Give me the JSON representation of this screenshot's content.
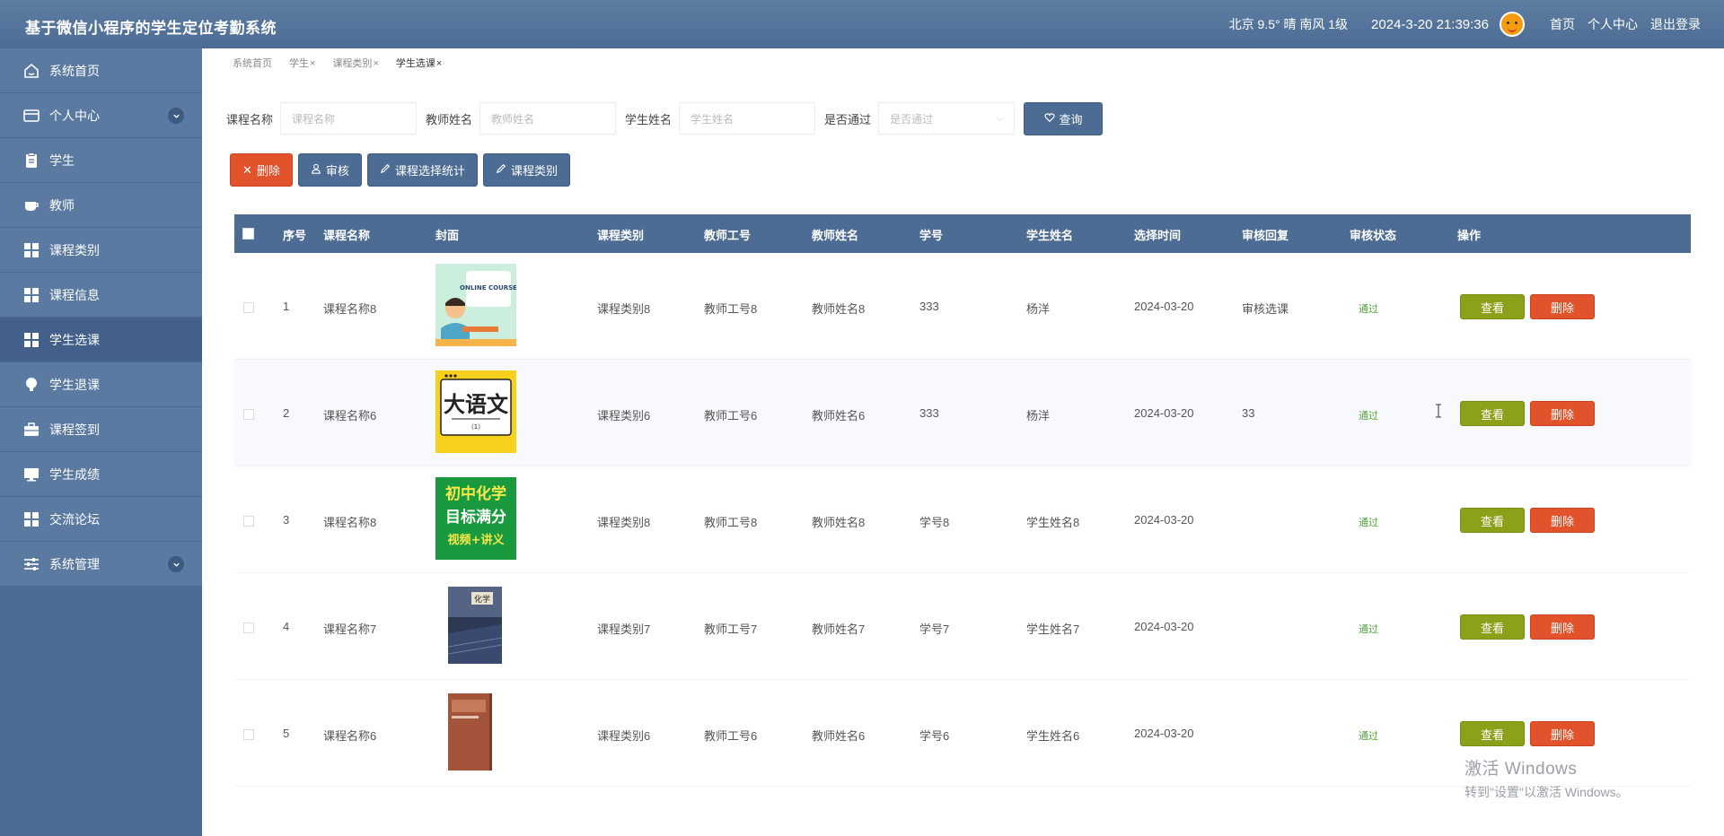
{
  "header": {
    "app_title": "基于微信小程序的学生定位考勤系统",
    "weather": "北京  9.5°  晴  南风  1级",
    "datetime": "2024-3-20 21:39:36",
    "links": [
      "首页",
      "个人中心",
      "退出登录"
    ]
  },
  "sidebar": {
    "items": [
      {
        "label": "系统首页",
        "icon": "home-icon"
      },
      {
        "label": "个人中心",
        "icon": "card-icon",
        "expandable": true
      },
      {
        "label": "学生",
        "icon": "clipboard-icon"
      },
      {
        "label": "教师",
        "icon": "cup-icon"
      },
      {
        "label": "课程类别",
        "icon": "grid-icon"
      },
      {
        "label": "课程信息",
        "icon": "grid-icon"
      },
      {
        "label": "学生选课",
        "icon": "grid-icon",
        "active": true
      },
      {
        "label": "学生退课",
        "icon": "bulb-icon"
      },
      {
        "label": "课程签到",
        "icon": "briefcase-icon"
      },
      {
        "label": "学生成绩",
        "icon": "monitor-icon"
      },
      {
        "label": "交流论坛",
        "icon": "grid-icon"
      },
      {
        "label": "系统管理",
        "icon": "sliders-icon",
        "expandable": true
      }
    ]
  },
  "tabs": [
    {
      "label": "系统首页",
      "closable": false
    },
    {
      "label": "学生",
      "closable": true
    },
    {
      "label": "课程类别",
      "closable": true
    },
    {
      "label": "学生选课",
      "closable": true,
      "active": true
    }
  ],
  "search": {
    "course_label": "课程名称",
    "course_placeholder": "课程名称",
    "teacher_label": "教师姓名",
    "teacher_placeholder": "教师姓名",
    "student_label": "学生姓名",
    "student_placeholder": "学生姓名",
    "passed_label": "是否通过",
    "passed_placeholder": "是否通过",
    "query_button": "查询"
  },
  "actions": {
    "delete": "删除",
    "review": "审核",
    "stats": "课程选择统计",
    "category": "课程类别"
  },
  "table": {
    "columns": [
      "序号",
      "课程名称",
      "封面",
      "课程类别",
      "教师工号",
      "教师姓名",
      "学号",
      "学生姓名",
      "选择时间",
      "审核回复",
      "审核状态",
      "操作"
    ],
    "rows": [
      {
        "no": "1",
        "course": "课程名称8",
        "category": "课程类别8",
        "teacher_id": "教师工号8",
        "teacher": "教师姓名8",
        "student_id": "333",
        "student": "杨洋",
        "time": "2024-03-20",
        "reply": "审核选课",
        "status": "通过",
        "cover": "online-course",
        "cover_text": "ONLINE COURSE"
      },
      {
        "no": "2",
        "course": "课程名称6",
        "category": "课程类别6",
        "teacher_id": "教师工号6",
        "teacher": "教师姓名6",
        "student_id": "333",
        "student": "杨洋",
        "time": "2024-03-20",
        "reply": "33",
        "status": "通过",
        "cover": "dayuwen",
        "cover_text": "大语文",
        "cover_subtext": "（1）"
      },
      {
        "no": "3",
        "course": "课程名称8",
        "category": "课程类别8",
        "teacher_id": "教师工号8",
        "teacher": "教师姓名8",
        "student_id": "学号8",
        "student": "学生姓名8",
        "time": "2024-03-20",
        "reply": "",
        "status": "通过",
        "cover": "chemistry",
        "cover_text": [
          "初中化学",
          "目标满分",
          "视频+讲义"
        ]
      },
      {
        "no": "4",
        "course": "课程名称7",
        "category": "课程类别7",
        "teacher_id": "教师工号7",
        "teacher": "教师姓名7",
        "student_id": "学号7",
        "student": "学生姓名7",
        "time": "2024-03-20",
        "reply": "",
        "status": "通过",
        "cover": "book-blue",
        "cover_text": "化学"
      },
      {
        "no": "5",
        "course": "课程名称6",
        "category": "课程类别6",
        "teacher_id": "教师工号6",
        "teacher": "教师姓名6",
        "student_id": "学号6",
        "student": "学生姓名6",
        "time": "2024-03-20",
        "reply": "",
        "status": "通过",
        "cover": "book-brown"
      }
    ],
    "view_button": "查看",
    "delete_button": "删除"
  },
  "watermark": {
    "line1": "激活 Windows",
    "line2": "转到\"设置\"以激活 Windows。"
  }
}
